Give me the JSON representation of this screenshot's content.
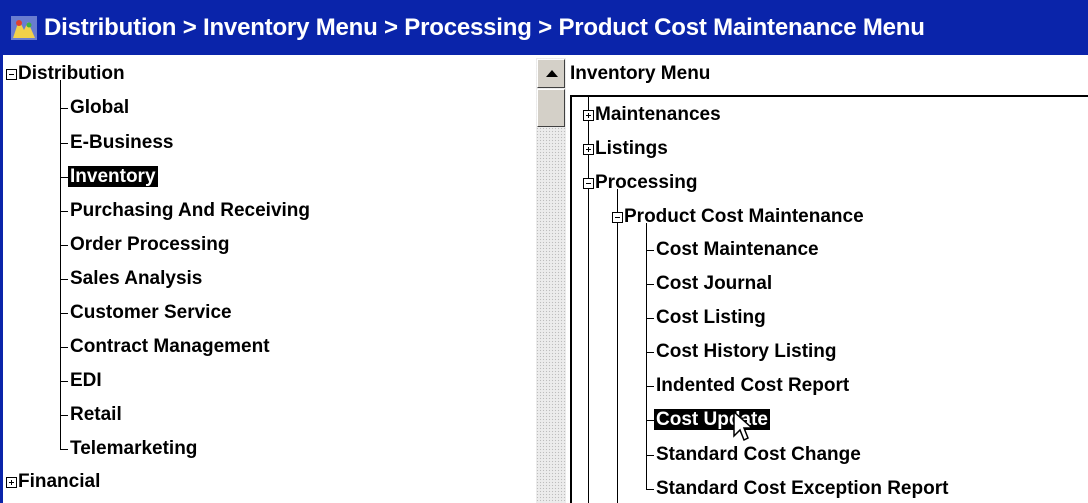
{
  "window": {
    "title": "Distribution > Inventory Menu > Processing > Product Cost Maintenance Menu",
    "icon": "app-icon"
  },
  "left_tree": {
    "root_label": "Distribution",
    "root_expander": "minus",
    "items": [
      {
        "label": "Global"
      },
      {
        "label": "E-Business"
      },
      {
        "label": "Inventory",
        "selected": true
      },
      {
        "label": "Purchasing And Receiving"
      },
      {
        "label": "Order Processing"
      },
      {
        "label": "Sales Analysis"
      },
      {
        "label": "Customer Service"
      },
      {
        "label": "Contract Management"
      },
      {
        "label": "EDI"
      },
      {
        "label": "Retail"
      },
      {
        "label": "Telemarketing"
      }
    ],
    "financial": {
      "label": "Financial",
      "expander": "plus"
    }
  },
  "scrollbar": {
    "up_icon": "scroll-up-arrow-icon"
  },
  "right_panel": {
    "header": "Inventory Menu",
    "maintenances": "Maintenances",
    "listings": "Listings",
    "processing": "Processing",
    "product_cost_maintenance": "Product Cost Maintenance",
    "items": [
      {
        "label": "Cost Maintenance"
      },
      {
        "label": "Cost Journal"
      },
      {
        "label": "Cost Listing"
      },
      {
        "label": "Cost History Listing"
      },
      {
        "label": "Indented Cost Report"
      },
      {
        "label": "Cost Update",
        "selected": true
      },
      {
        "label": "Standard Cost Change"
      },
      {
        "label": "Standard Cost Exception Report"
      }
    ]
  },
  "colors": {
    "titlebar": "#0a24aa",
    "selection": "#000000",
    "scroll_track": "#ececec"
  }
}
